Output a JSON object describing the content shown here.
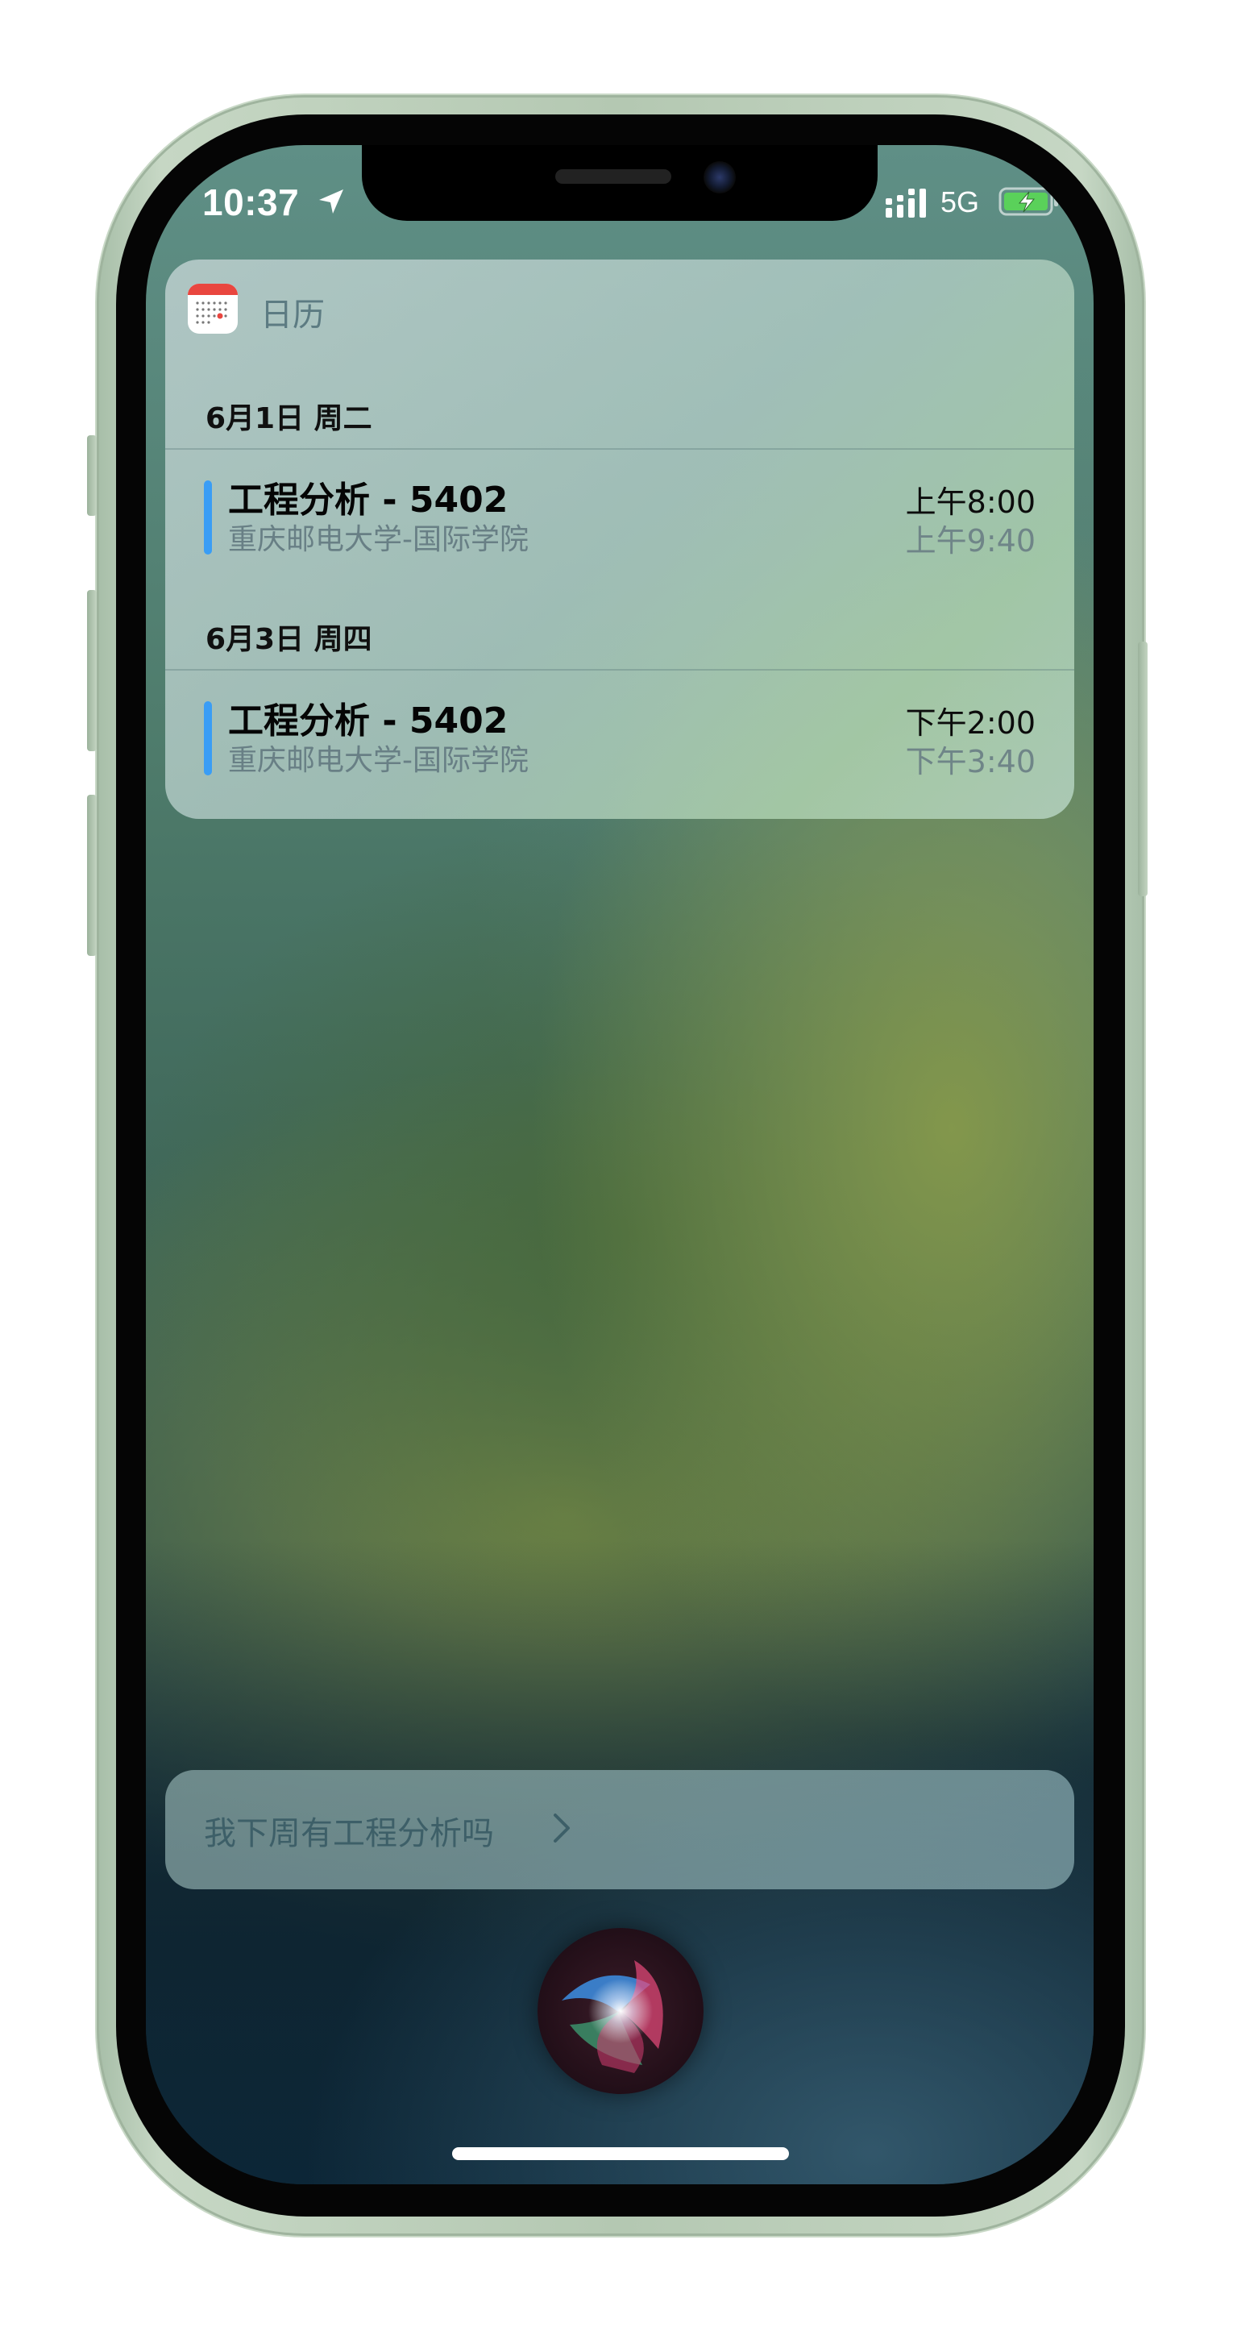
{
  "status_bar": {
    "time": "10:37",
    "network": "5G"
  },
  "calendar_widget": {
    "app_name": "日历",
    "days": [
      {
        "date_label": "6月1日 周二",
        "events": [
          {
            "title": "工程分析 - 5402",
            "location": "重庆邮电大学-国际学院",
            "start": "上午8:00",
            "end": "上午9:40",
            "color": "#3a9df5"
          }
        ]
      },
      {
        "date_label": "6月3日 周四",
        "events": [
          {
            "title": "工程分析 - 5402",
            "location": "重庆邮电大学-国际学院",
            "start": "下午2:00",
            "end": "下午3:40",
            "color": "#3a9df5"
          }
        ]
      }
    ]
  },
  "siri": {
    "suggestion": "我下周有工程分析吗"
  },
  "icons": {
    "location": "location-arrow-icon",
    "signal": "cellular-signal-icon",
    "battery": "battery-charging-icon",
    "calendar": "calendar-app-icon",
    "chevron": "chevron-right-icon",
    "siri": "siri-orb-icon"
  }
}
